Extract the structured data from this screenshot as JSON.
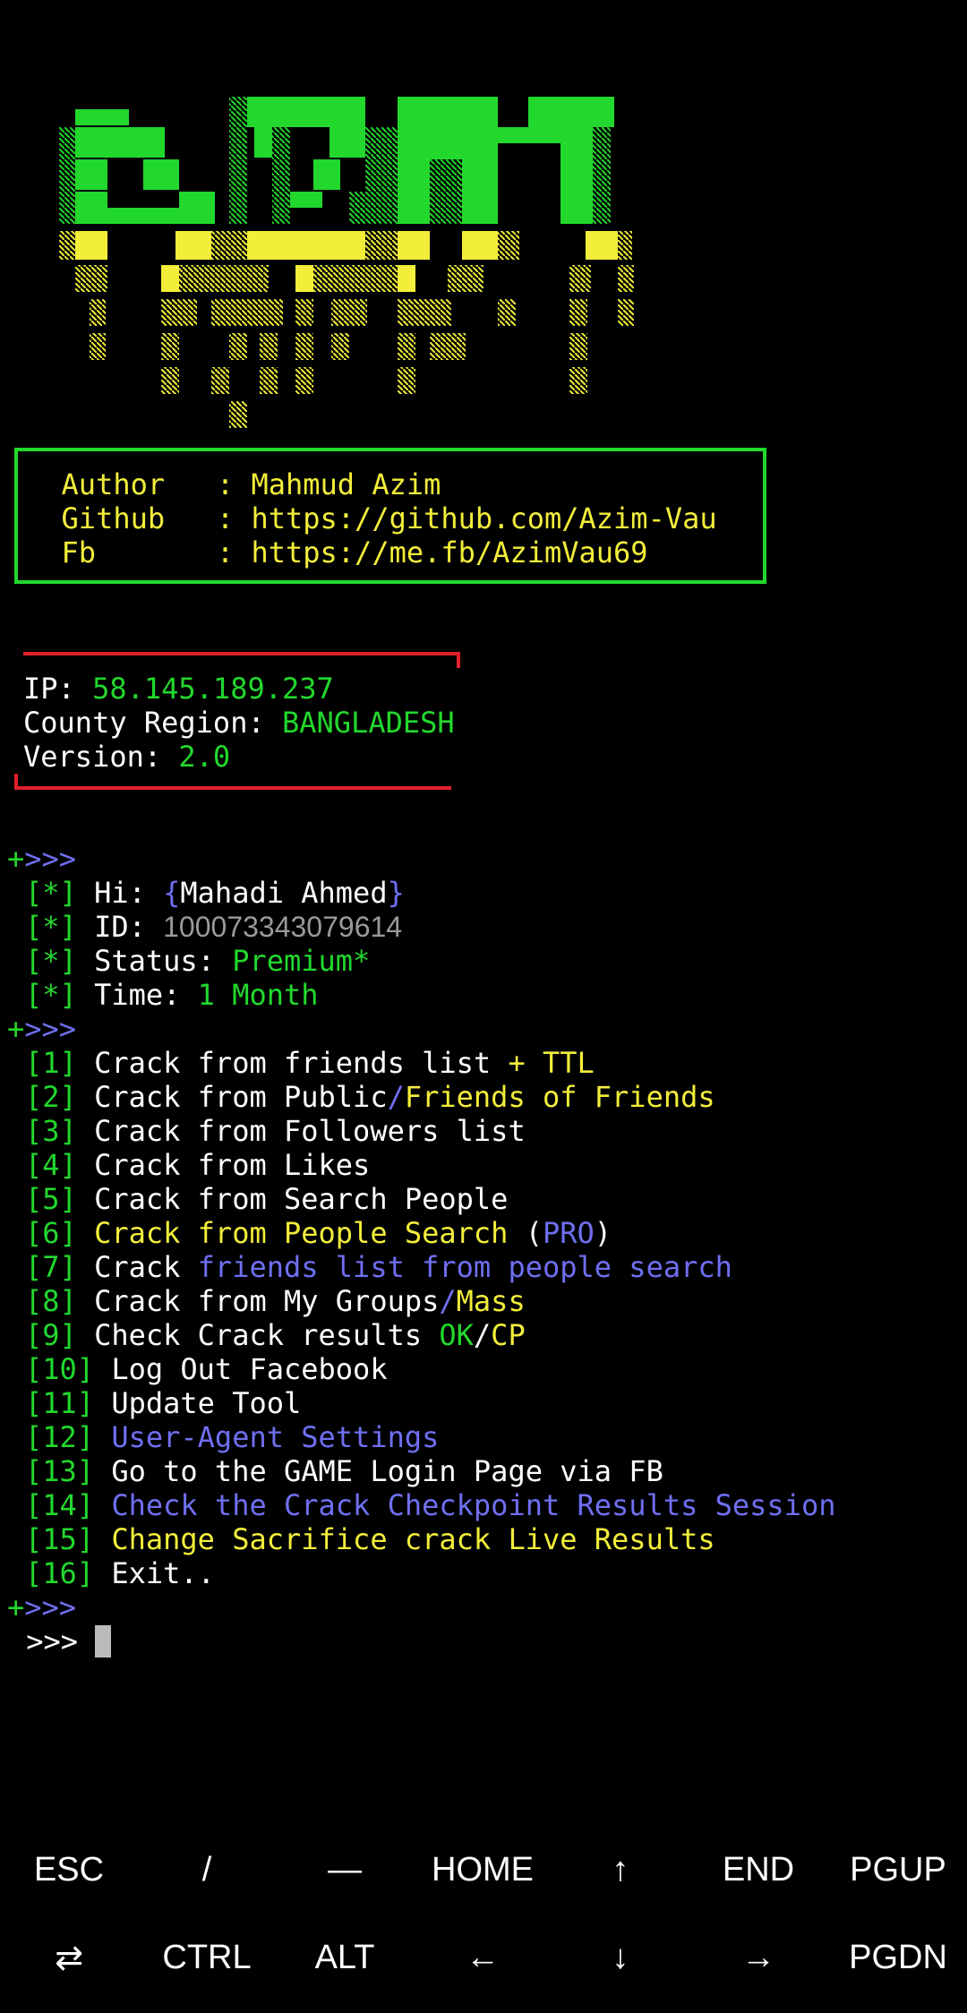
{
  "author_box": {
    "author": "  Author   : Mahmud Azim",
    "github": "  Github   : https://github.com/Azim-Vau",
    "fb": "  Fb       : https://me.fb/AzimVau69"
  },
  "net_info": {
    "ip_label": "IP: ",
    "ip_value": "58.145.189.237",
    "region_label": "County Region: ",
    "region_value": "BANGLADESH",
    "version_label": "Version: ",
    "version_value": "2.0"
  },
  "separator": ">>>",
  "user": {
    "bullet": "[*]",
    "hi_label": " Hi: ",
    "name": "Mahadi Ahmed",
    "id_label": " ID: ",
    "id": "100073343079614",
    "status_label": " Status: ",
    "status": "Premium*",
    "time_label": " Time: ",
    "time": "1 Month"
  },
  "menu": {
    "m1": {
      "num": "[1]",
      "a": " Crack from friends list ",
      "b": "+ TTL"
    },
    "m2": {
      "num": "[2]",
      "a": " Crack from Public",
      "slash": "/",
      "b": "Friends of Friends"
    },
    "m3": {
      "num": "[3]",
      "a": " Crack from Followers list"
    },
    "m4": {
      "num": "[4]",
      "a": " Crack from Likes"
    },
    "m5": {
      "num": "[5]",
      "a": " Crack from Search People"
    },
    "m6": {
      "num": "[6]",
      "a": " Crack from People Search",
      "open": " (",
      "b": "PRO",
      "close": ")"
    },
    "m7": {
      "num": "[7]",
      "a": " Crack ",
      "b": "friends list from people search"
    },
    "m8": {
      "num": "[8]",
      "a": " Crack from My Groups",
      "slash": "/",
      "b": "Mass"
    },
    "m9": {
      "num": "[9]",
      "a": " Check Crack results ",
      "ok": "OK",
      "slash": "/",
      "cp": "CP"
    },
    "m10": {
      "num": "[10]",
      "a": " Log Out Facebook"
    },
    "m11": {
      "num": "[11]",
      "a": " Update Tool"
    },
    "m12": {
      "num": "[12]",
      "a": " User-Agent Settings"
    },
    "m13": {
      "num": "[13]",
      "a": " Go to the GAME Login Page via FB"
    },
    "m14": {
      "num": "[14]",
      "a": " Check the Crack Checkpoint Results Session"
    },
    "m15": {
      "num": "[15]",
      "a": " Change Sacrifice crack Live Results"
    },
    "m16": {
      "num": "[16]",
      "a": " Exit.."
    }
  },
  "prompt": " >>> ",
  "extra_keys": {
    "esc": "ESC",
    "slash": "/",
    "dash": "—",
    "home": "HOME",
    "up": "↑",
    "end": "END",
    "pgup": "PGUP",
    "tab": "⇄",
    "ctrl": "CTRL",
    "alt": "ALT",
    "left": "←",
    "down": "↓",
    "right": "→",
    "pgdn": "PGDN"
  },
  "colors": {
    "green": "#22d82d",
    "yellow": "#f2ee3a",
    "blue": "#6f6ff2",
    "red": "#e0202a",
    "gray": "#9a9a9a"
  }
}
